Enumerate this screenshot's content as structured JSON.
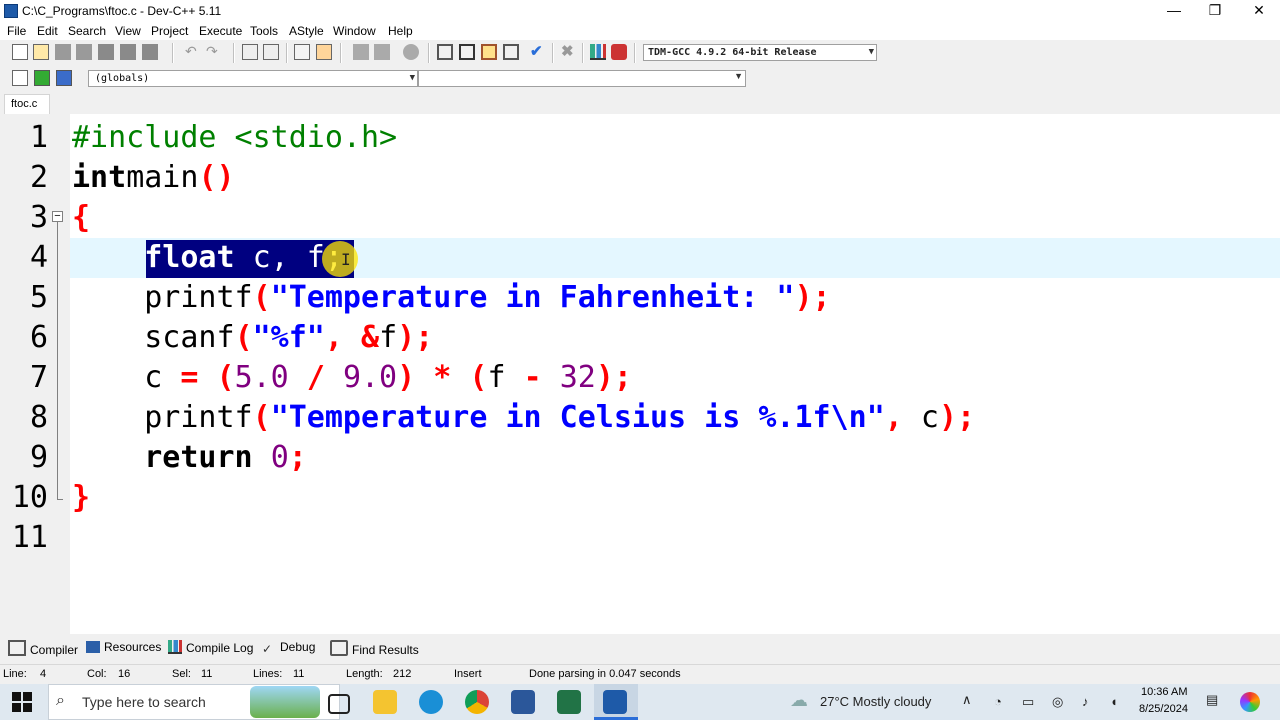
{
  "window": {
    "title": "C:\\C_Programs\\ftoc.c - Dev-C++ 5.11",
    "controls": {
      "minimize": "—",
      "maximize": "❐",
      "close": "✕"
    }
  },
  "menu": [
    "File",
    "Edit",
    "Search",
    "View",
    "Project",
    "Execute",
    "Tools",
    "AStyle",
    "Window",
    "Help"
  ],
  "toolbar": {
    "compiler": "TDM-GCC 4.9.2 64-bit Release",
    "scope": "(globals)"
  },
  "tabs": {
    "active": "ftoc.c"
  },
  "editor": {
    "line_numbers": [
      "1",
      "2",
      "3",
      "4",
      "5",
      "6",
      "7",
      "8",
      "9",
      "10",
      "11"
    ],
    "current_line": 4
  },
  "bottom_tabs": [
    "Compiler",
    "Resources",
    "Compile Log",
    "Debug",
    "Find Results"
  ],
  "status": {
    "line": "Line:",
    "line_val": "4",
    "col": "Col:",
    "col_val": "16",
    "sel": "Sel:",
    "sel_val": "11",
    "lines": "Lines:",
    "lines_val": "11",
    "length": "Length:",
    "length_val": "212",
    "mode": "Insert",
    "message": "Done parsing in 0.047 seconds"
  },
  "taskbar": {
    "search_placeholder": "Type here to search",
    "weather": "27°C  Mostly cloudy",
    "time": "10:36 AM",
    "date": "8/25/2024"
  }
}
